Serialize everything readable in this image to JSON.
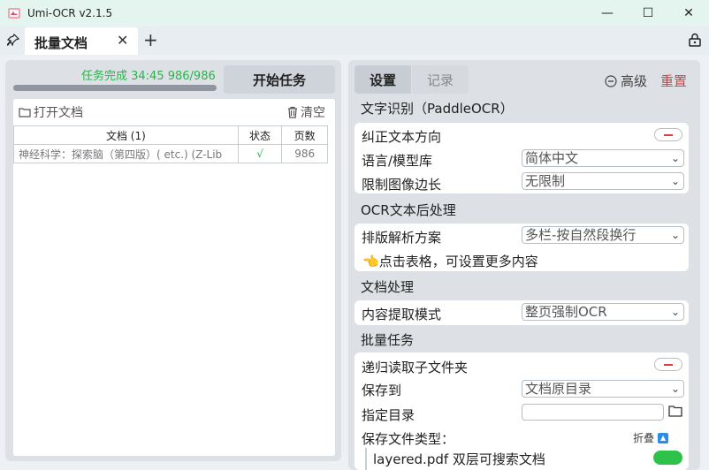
{
  "window": {
    "title": "Umi-OCR v2.1.5",
    "minimize_glyph": "—",
    "maximize_glyph": "☐",
    "close_glyph": "✕"
  },
  "tabs": {
    "active_label": "批量文档",
    "close_glyph": "✕",
    "add_glyph": "+"
  },
  "left": {
    "progress_text": "任务完成  34:45  986/986",
    "progress_value": 1.0,
    "start_button": "开始任务",
    "open_docs": "打开文档",
    "clear": "清空",
    "table": {
      "headers": [
        "文档 (1)",
        "状态",
        "页数"
      ],
      "rows": [
        {
          "name": "神经科学：探索脑（第四版）( etc.) (Z-Lib",
          "status": "√",
          "pages": "986"
        }
      ]
    }
  },
  "right": {
    "seg_settings": "设置",
    "seg_records": "记录",
    "advanced": "高级",
    "reset": "重置",
    "sec_ocr": "文字识别（PaddleOCR）",
    "correct_direction": "纠正文本方向",
    "language_label": "语言/模型库",
    "language_value": "简体中文",
    "limit_label": "限制图像边长",
    "limit_value": "无限制",
    "sec_post": "OCR文本后处理",
    "layout_label": "排版解析方案",
    "layout_value": "多栏-按自然段换行",
    "hint_icon": "👈",
    "hint_text": "点击表格，可设置更多内容",
    "sec_doc": "文档处理",
    "extract_label": "内容提取模式",
    "extract_value": "整页强制OCR",
    "sec_batch": "批量任务",
    "recursive_label": "递归读取子文件夹",
    "save_to_label": "保存到",
    "save_to_value": "文档原目录",
    "dir_label": "指定目录",
    "file_types_label": "保存文件类型：",
    "fold_label": "折叠",
    "partial_row_text": "layered.pdf 双层可搜索文档"
  },
  "colors": {
    "accent_green": "#2bb34a",
    "reset_red": "#e23b3b",
    "fold_blue": "#2a8ee8"
  }
}
